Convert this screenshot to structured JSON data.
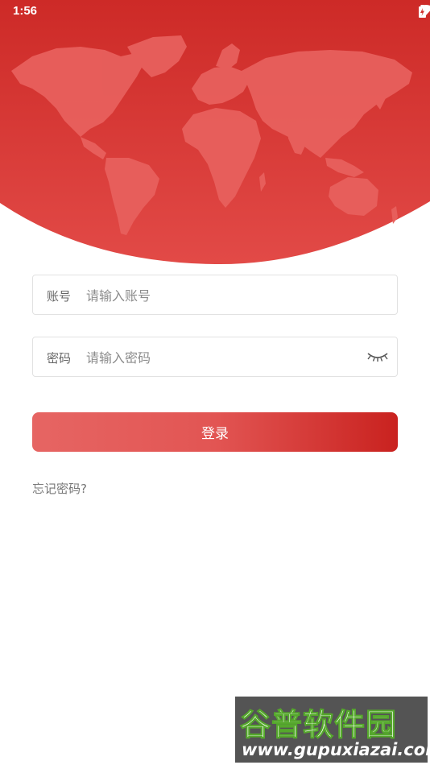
{
  "status_bar": {
    "time": "1:56"
  },
  "login_form": {
    "account": {
      "label": "账号",
      "placeholder": "请输入账号",
      "value": ""
    },
    "password": {
      "label": "密码",
      "placeholder": "请输入密码",
      "value": ""
    },
    "submit_label": "登录",
    "forgot_password": "忘记密码?"
  },
  "watermark": {
    "name": "谷普软件园",
    "url": "www.gupuxiazai.com"
  },
  "colors": {
    "header_red": "#d0302c",
    "map_land": "#e8605d",
    "button_gradient_start": "#e66563",
    "button_gradient_end": "#c9221f"
  }
}
